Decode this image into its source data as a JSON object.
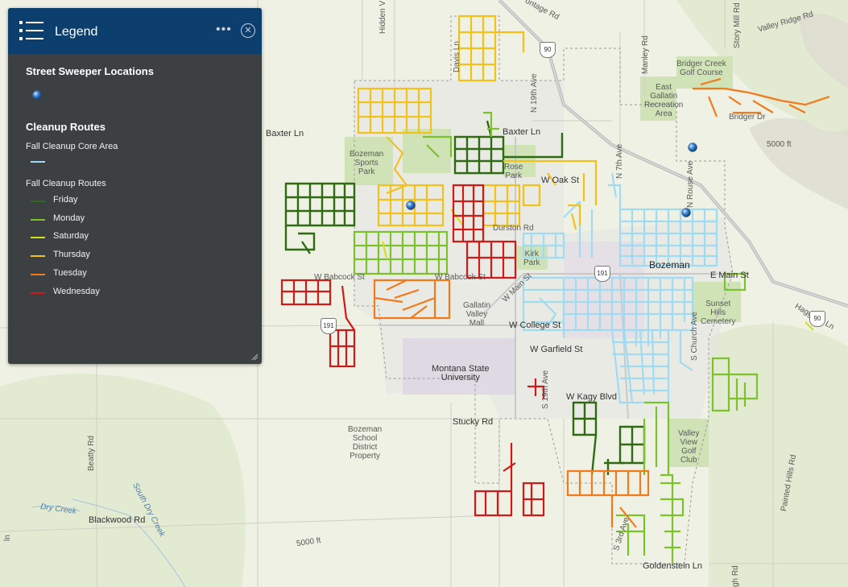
{
  "legend": {
    "title": "Legend",
    "more_icon": "ellipsis-icon",
    "close_icon": "close-circle-icon",
    "sections": {
      "sweeper_title": "Street Sweeper Locations",
      "routes_title": "Cleanup Routes",
      "core_area_label": "Fall Cleanup Core Area",
      "routes_sublabel": "Fall Cleanup Routes"
    },
    "routes": [
      {
        "label": "Friday",
        "color": "#2f6b12"
      },
      {
        "label": "Monday",
        "color": "#7cc22a"
      },
      {
        "label": "Saturday",
        "color": "#d2e11a"
      },
      {
        "label": "Thursday",
        "color": "#f2c21b"
      },
      {
        "label": "Tuesday",
        "color": "#f07a1c"
      },
      {
        "label": "Wednesday",
        "color": "#d01a1a"
      }
    ],
    "core_area_color": "#9fdcf2"
  },
  "map": {
    "labels": {
      "hidden_v": "Hidden V",
      "frontage_rd": "ontage Rd",
      "davis_ln": "Davis Ln",
      "baxter_ln_w": "Baxter Ln",
      "baxter_ln_e": "Baxter Ln",
      "n19th": "N 19th Ave",
      "bozeman_sports_park": "Bozeman\nSports\nPark",
      "rose_park": "Rose\nPark",
      "w_oak_st": "W Oak St",
      "durston_rd": "Durston Rd",
      "kirk_park": "Kirk\nPark",
      "w_babcock_st_1": "W Babcock St",
      "w_babcock_st_2": "W Babcock St",
      "w_main_st": "W Main St",
      "gallatin_valley_mall": "Gallatin\nValley\nMall",
      "w_college_st": "W College St",
      "w_garfield_st": "W Garfield St",
      "msu": "Montana State\nUniversity",
      "w_kagy_blvd": "W Kagy Blvd",
      "s19th": "S 19th Ave",
      "stucky_rd": "Stucky Rd",
      "school_property": "Bozeman\nSchool\nDistrict\nProperty",
      "beatty_rd": "Beatty Rd",
      "dry_creek": "Dry Creek",
      "blackwood_rd": "Blackwood Rd",
      "south_dry_creek": "South Dry Creek",
      "elev_5000_sw": "5000 ft",
      "elev_5000_ne": "5000 ft",
      "bozeman": "Bozeman",
      "e_main_st": "E Main St",
      "n7th": "N 7th Ave",
      "n_rouse": "N Rouse Ave",
      "manley_rd": "Manley Rd",
      "bridger_creek_gc": "Bridger Creek\nGolf Course",
      "east_gallatin": "East\nGallatin\nRecreation\nArea",
      "bridger_dr": "Bridger Dr",
      "story_mill_rd": "Story Mill Rd",
      "valley_ridge_rd": "Valley Ridge Rd",
      "sunset_hills": "Sunset\nHills\nCemetery",
      "haggerty_ln": "Haggerty Ln",
      "s_church_ave": "S Church Ave",
      "valley_view_gc": "Valley\nView\nGolf\nClub",
      "s3rd": "S 3rd Ave",
      "painted_hills": "Painted Hills Rd",
      "goldenstein_ln": "Goldenstein Ln",
      "sh_rd": "gh Rd",
      "n_ln": "ln",
      "shield_90_n": "90",
      "shield_191": "191",
      "shield_191_w": "191",
      "shield_90_e": "90"
    }
  }
}
